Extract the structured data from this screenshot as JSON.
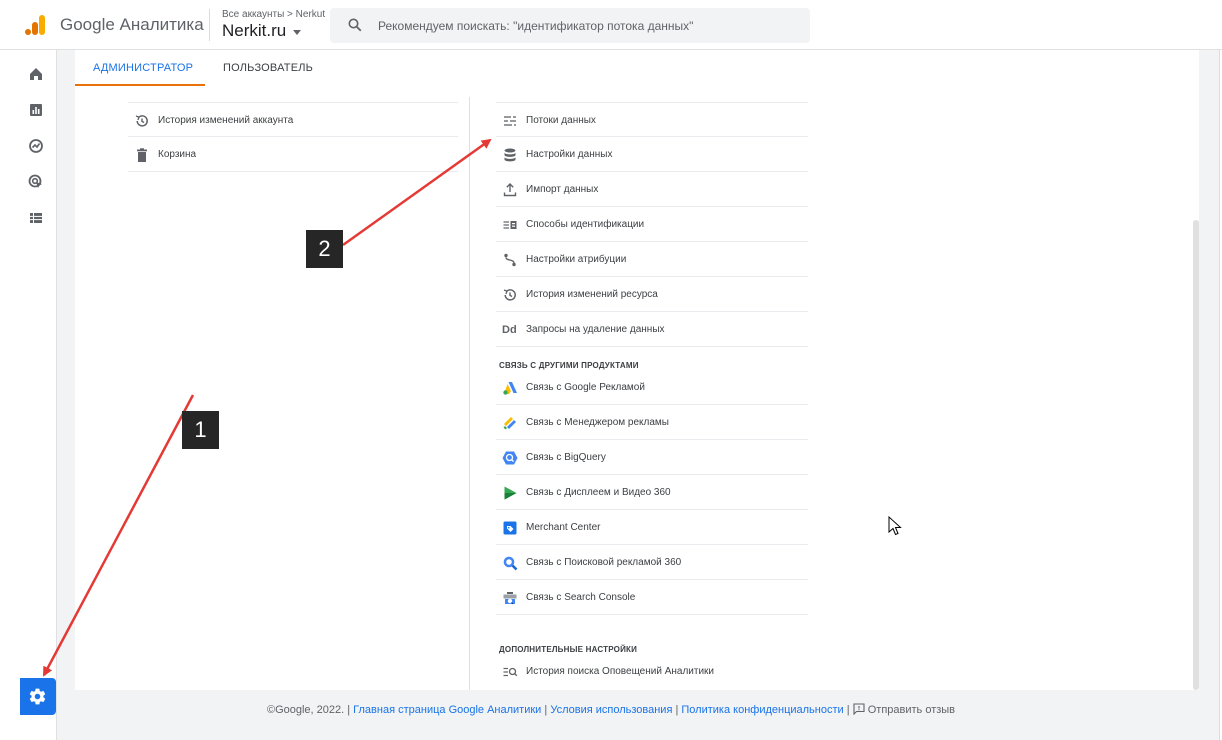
{
  "topbar": {
    "brand": "Google Аналитика",
    "account_crumb": "Все аккаунты > Nerkut",
    "account_name": "Nerkit.ru",
    "search_placeholder": "Рекомендуем поискать: \"идентификатор потока данных\""
  },
  "tabs": [
    {
      "label": "АДМИНИСТРАТОР",
      "active": true
    },
    {
      "label": "ПОЛЬЗОВАТЕЛЬ",
      "active": false
    }
  ],
  "account_column": [
    {
      "label": "История изменений аккаунта",
      "icon": "history-icon"
    },
    {
      "label": "Корзина",
      "icon": "trash-icon"
    }
  ],
  "property_column": {
    "items": [
      {
        "label": "Потоки данных",
        "icon": "data-streams-icon"
      },
      {
        "label": "Настройки данных",
        "icon": "database-icon"
      },
      {
        "label": "Импорт данных",
        "icon": "upload-icon"
      },
      {
        "label": "Способы идентификации",
        "icon": "reporting-identity-icon"
      },
      {
        "label": "Настройки атрибуции",
        "icon": "attribution-icon"
      },
      {
        "label": "История изменений ресурса",
        "icon": "history-icon"
      },
      {
        "label": "Запросы на удаление данных",
        "icon": "dd-icon",
        "icon_text": "Dd"
      }
    ],
    "links_section": {
      "title": "СВЯЗЬ С ДРУГИМИ ПРОДУКТАМИ",
      "items": [
        {
          "label": "Связь с Google Рекламой",
          "icon": "google-ads-icon"
        },
        {
          "label": "Связь с Менеджером рекламы",
          "icon": "ad-manager-icon"
        },
        {
          "label": "Связь с BigQuery",
          "icon": "bigquery-icon"
        },
        {
          "label": "Связь с Дисплеем и Видео 360",
          "icon": "display-video-360-icon"
        },
        {
          "label": "Merchant Center",
          "icon": "merchant-center-icon"
        },
        {
          "label": "Связь с Поисковой рекламой 360",
          "icon": "search-ads-360-icon"
        },
        {
          "label": "Связь с Search Console",
          "icon": "search-console-icon"
        }
      ]
    },
    "extra_section": {
      "title": "ДОПОЛНИТЕЛЬНЫЕ НАСТРОЙКИ",
      "items": [
        {
          "label": "История поиска Оповещений Аналитики",
          "icon": "search-history-icon"
        }
      ]
    }
  },
  "footer": {
    "copyright": "©Google, 2022. |",
    "home_link": "Главная страница Google Аналитики",
    "terms_link": "Условия использования",
    "privacy_link": "Политика конфиденциальности",
    "sep": "|",
    "feedback": "Отправить отзыв"
  },
  "annotations": {
    "badge_1": "1",
    "badge_2": "2"
  },
  "colors": {
    "accent": "#1a73e8",
    "tab_underline": "#e8710a",
    "annotation_arrow": "#e53935",
    "badge_bg": "#262626"
  }
}
